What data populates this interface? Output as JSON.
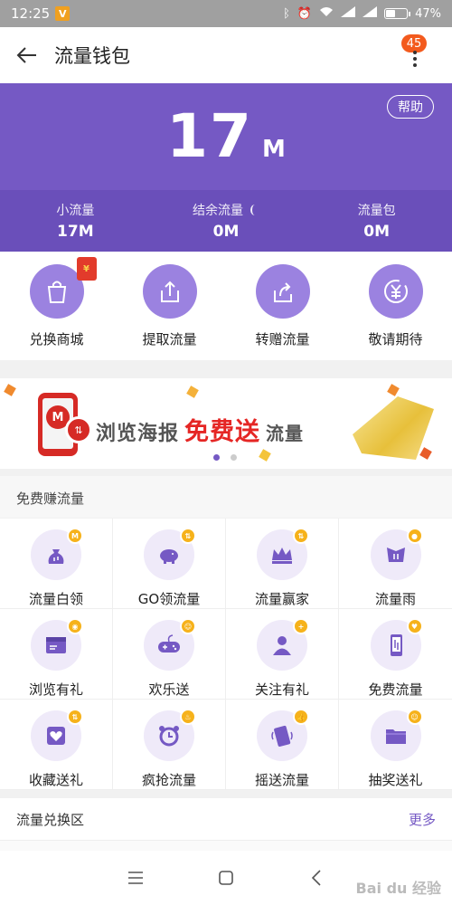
{
  "status_bar": {
    "time": "12:25",
    "app_badge": "V",
    "battery": "47%",
    "battery_level": 0.47
  },
  "header": {
    "title": "流量钱包",
    "notification_count": "45"
  },
  "hero": {
    "help_label": "帮助",
    "amount": "17",
    "unit": "M",
    "stats": [
      {
        "label": "小流量",
        "value": "17M"
      },
      {
        "label": "结余流量",
        "value": "0M"
      },
      {
        "label": "流量包",
        "value": "0M"
      }
    ]
  },
  "quick_actions": [
    {
      "label": "兑换商城",
      "icon": "shopping-bag-icon"
    },
    {
      "label": "提取流量",
      "icon": "upload-icon"
    },
    {
      "label": "转赠流量",
      "icon": "share-icon"
    },
    {
      "label": "敬请期待",
      "icon": "yuan-icon"
    }
  ],
  "red_packet": "¥",
  "banner": {
    "text_prefix": "浏览海报",
    "text_highlight": "免费送",
    "text_suffix": "流量",
    "logo": "M",
    "coin": "⇅",
    "slide_index": 1,
    "slide_count": 2
  },
  "earn_section": {
    "title": "免费赚流量",
    "items": [
      {
        "label": "流量白领",
        "icon": "money-bag-icon",
        "badge": "M"
      },
      {
        "label": "GO领流量",
        "icon": "piggy-bank-icon",
        "badge": "⇅"
      },
      {
        "label": "流量赢家",
        "icon": "crown-icon",
        "badge": "⇅"
      },
      {
        "label": "流量雨",
        "icon": "rain-box-icon",
        "badge": "●"
      },
      {
        "label": "浏览有礼",
        "icon": "browser-icon",
        "badge": "◉"
      },
      {
        "label": "欢乐送",
        "icon": "gamepad-icon",
        "badge": "☺"
      },
      {
        "label": "关注有礼",
        "icon": "user-add-icon",
        "badge": "+"
      },
      {
        "label": "免费流量",
        "icon": "phone-data-icon",
        "badge": "♥"
      },
      {
        "label": "收藏送礼",
        "icon": "heart-card-icon",
        "badge": "⇅"
      },
      {
        "label": "疯抢流量",
        "icon": "alarm-clock-icon",
        "badge": "♨"
      },
      {
        "label": "摇送流量",
        "icon": "shake-phone-icon",
        "badge": "👍"
      },
      {
        "label": "抽奖送礼",
        "icon": "folder-icon",
        "badge": "☺"
      }
    ]
  },
  "exchange_section": {
    "title": "流量兑换区",
    "more_label": "更多"
  },
  "watermark": "Bai du 经验",
  "colors": {
    "primary": "#7559c4",
    "primary_dark": "#6a4fba",
    "accent": "#f6b21b",
    "badge_red": "#f35a1d"
  }
}
